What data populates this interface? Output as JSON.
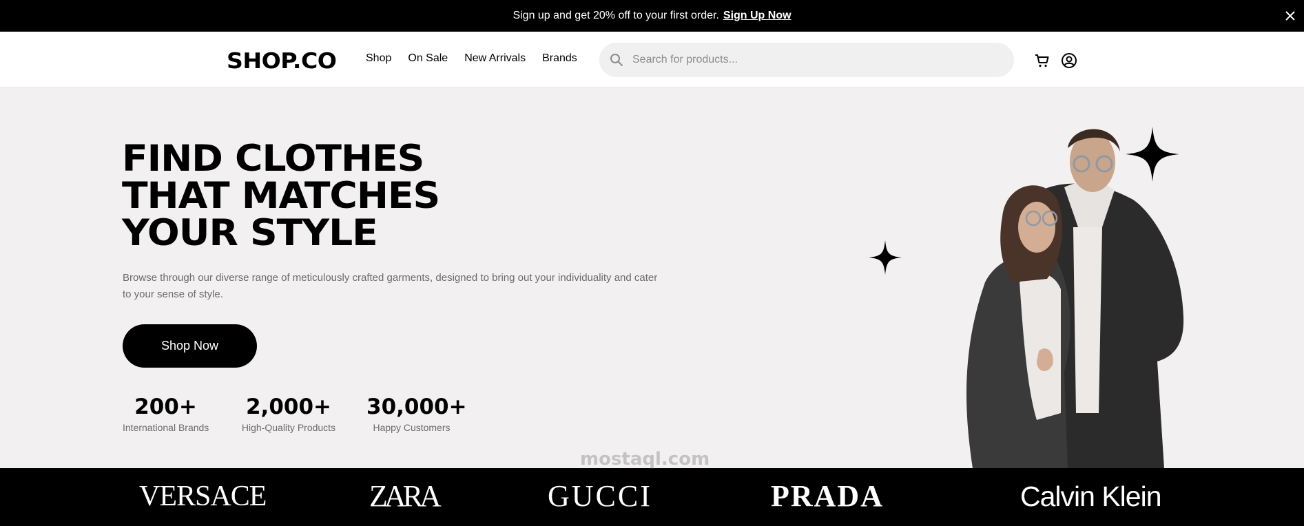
{
  "promo": {
    "text": "Sign up and get 20% off to your first order.",
    "cta": "Sign Up Now",
    "close_icon": "close-icon"
  },
  "header": {
    "logo": "SHOP.CO",
    "nav": [
      "Shop",
      "On Sale",
      "New Arrivals",
      "Brands"
    ],
    "search_placeholder": "Search for products...",
    "icons": [
      "search-icon",
      "cart-icon",
      "account-icon"
    ]
  },
  "hero": {
    "title_lines": [
      "FIND CLOTHES",
      "THAT MATCHES",
      "YOUR STYLE"
    ],
    "description": "Browse through our diverse range of meticulously crafted garments, designed to bring out your individuality and cater to your sense of style.",
    "button": "Shop Now",
    "stats": [
      {
        "value": "200+",
        "label": "International Brands"
      },
      {
        "value": "2,000+",
        "label": "High-Quality Products"
      },
      {
        "value": "30,000+",
        "label": "Happy Customers"
      }
    ]
  },
  "brands": [
    "VERSACE",
    "ZARA",
    "GUCCI",
    "PRADA",
    "Calvin Klein"
  ],
  "watermark": "mostaql.com",
  "colors": {
    "primary": "#000000",
    "hero_bg": "#f2f0f1",
    "muted_text": "#6b6b6b",
    "search_bg": "#f0f0f0"
  }
}
